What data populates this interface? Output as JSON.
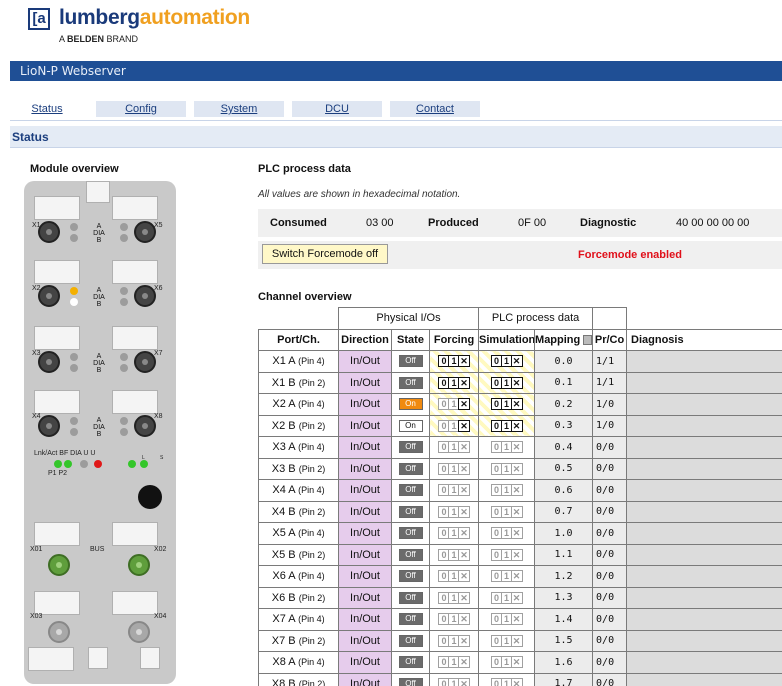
{
  "header": {
    "logo_glyph": "[a",
    "logo_part1": "lumberg",
    "logo_part2": "automation",
    "brand_prefix": "A ",
    "brand_bold": "BELDEN",
    "brand_suffix": " BRAND",
    "window_title": "LioN-P Webserver"
  },
  "tabs": [
    "Status",
    "Config",
    "System",
    "DCU",
    "Contact"
  ],
  "section_title": "Status",
  "module_overview": {
    "title": "Module overview",
    "port_labels": [
      "X1",
      "X5",
      "X2",
      "X6",
      "X3",
      "X7",
      "X4",
      "X8"
    ],
    "dia_label_a": "A",
    "dia_label_mid": "DIA",
    "dia_label_b": "B",
    "led_labels": "Lnk/Act  BF  DIA     U  U",
    "led_sub": "P1  P2",
    "led_sub_l": "L",
    "led_sub_s": "S",
    "bus_ports": [
      "X01",
      "BUS",
      "X02"
    ],
    "power_ports": [
      "X03",
      "X04"
    ]
  },
  "plc": {
    "title": "PLC process data",
    "note": "All values are shown in hexadecimal notation.",
    "consumed_label": "Consumed",
    "consumed_value": "03 00",
    "produced_label": "Produced",
    "produced_value": "0F 00",
    "diagnostic_label": "Diagnostic",
    "diagnostic_value": "40 00 00 00 00",
    "force_button": "Switch Forcemode off",
    "force_status": "Forcemode enabled"
  },
  "channel": {
    "title": "Channel overview",
    "group_physical": "Physical I/Os",
    "group_plc": "PLC process data",
    "headers": [
      "Port/Ch.",
      "Direction",
      "State",
      "Forcing",
      "Simulation",
      "Mapping",
      "Pr/Co",
      "Diagnosis"
    ],
    "rows": [
      {
        "port": "X1 A",
        "pin": "(Pin 4)",
        "dir": "In/Out",
        "state": "Off",
        "map": "0.0",
        "prco": "1/1"
      },
      {
        "port": "X1 B",
        "pin": "(Pin 2)",
        "dir": "In/Out",
        "state": "Off",
        "map": "0.1",
        "prco": "1/1"
      },
      {
        "port": "X2 A",
        "pin": "(Pin 4)",
        "dir": "In/Out",
        "state": "On",
        "map": "0.2",
        "prco": "1/0"
      },
      {
        "port": "X2 B",
        "pin": "(Pin 2)",
        "dir": "In/Out",
        "state": "On",
        "map": "0.3",
        "prco": "1/0"
      },
      {
        "port": "X3 A",
        "pin": "(Pin 4)",
        "dir": "In/Out",
        "state": "Off",
        "map": "0.4",
        "prco": "0/0"
      },
      {
        "port": "X3 B",
        "pin": "(Pin 2)",
        "dir": "In/Out",
        "state": "Off",
        "map": "0.5",
        "prco": "0/0"
      },
      {
        "port": "X4 A",
        "pin": "(Pin 4)",
        "dir": "In/Out",
        "state": "Off",
        "map": "0.6",
        "prco": "0/0"
      },
      {
        "port": "X4 B",
        "pin": "(Pin 2)",
        "dir": "In/Out",
        "state": "Off",
        "map": "0.7",
        "prco": "0/0"
      },
      {
        "port": "X5 A",
        "pin": "(Pin 4)",
        "dir": "In/Out",
        "state": "Off",
        "map": "1.0",
        "prco": "0/0"
      },
      {
        "port": "X5 B",
        "pin": "(Pin 2)",
        "dir": "In/Out",
        "state": "Off",
        "map": "1.1",
        "prco": "0/0"
      },
      {
        "port": "X6 A",
        "pin": "(Pin 4)",
        "dir": "In/Out",
        "state": "Off",
        "map": "1.2",
        "prco": "0/0"
      },
      {
        "port": "X6 B",
        "pin": "(Pin 2)",
        "dir": "In/Out",
        "state": "Off",
        "map": "1.3",
        "prco": "0/0"
      },
      {
        "port": "X7 A",
        "pin": "(Pin 4)",
        "dir": "In/Out",
        "state": "Off",
        "map": "1.4",
        "prco": "0/0"
      },
      {
        "port": "X7 B",
        "pin": "(Pin 2)",
        "dir": "In/Out",
        "state": "Off",
        "map": "1.5",
        "prco": "0/0"
      },
      {
        "port": "X8 A",
        "pin": "(Pin 4)",
        "dir": "In/Out",
        "state": "Off",
        "map": "1.6",
        "prco": "0/0"
      },
      {
        "port": "X8 B",
        "pin": "(Pin 2)",
        "dir": "In/Out",
        "state": "Off",
        "map": "1.7",
        "prco": "0/0"
      }
    ]
  },
  "colors": {
    "titlebar": "#1f4f95",
    "force_status": "#e0101a",
    "direction_bg": "#e6ccec",
    "state_on": "#f08a10"
  }
}
